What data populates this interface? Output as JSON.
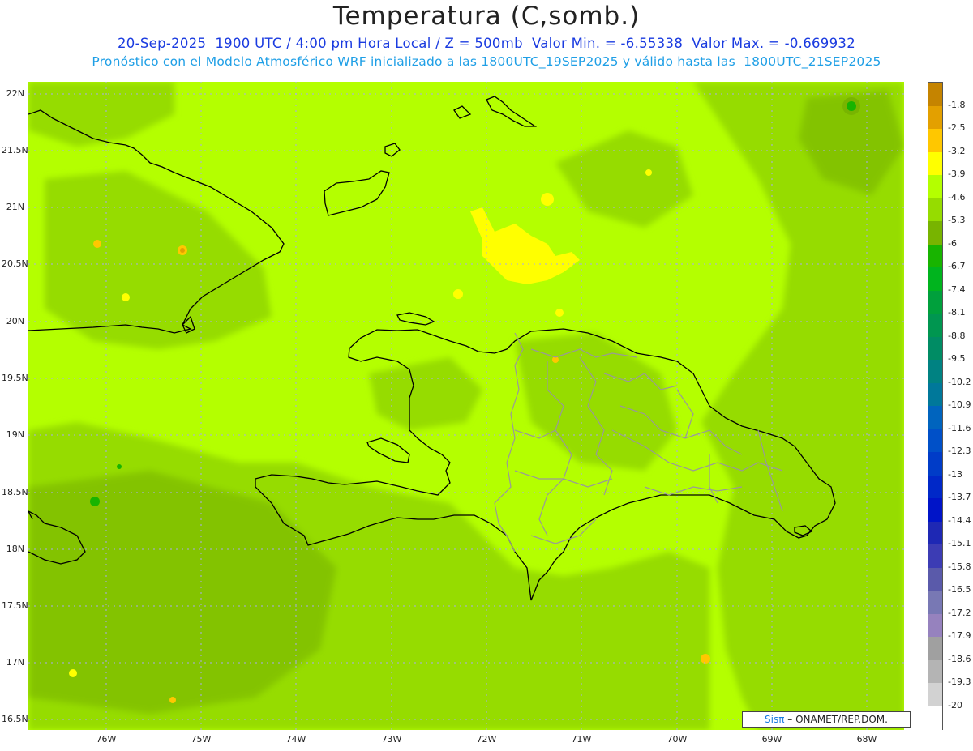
{
  "title": "Temperatura (C,somb.)",
  "subtitle_line1": "20-Sep-2025  1900 UTC / 4:00 pm Hora Local / Z = 500mb  Valor Min. = -6.55338  Valor Max. = -0.669932",
  "subtitle_line2": "Pronóstico con el Modelo Atmosférico WRF inicializado a las 1800UTC_19SEP2025 y válido hasta las  1800UTC_21SEP2025",
  "lat_labels": [
    "22N",
    "21.5N",
    "21N",
    "20.5N",
    "20N",
    "19.5N",
    "19N",
    "18.5N",
    "18N",
    "17.5N",
    "17N",
    "16.5N"
  ],
  "lon_labels": [
    "76W",
    "75W",
    "74W",
    "73W",
    "72W",
    "71W",
    "70W",
    "69W",
    "68W"
  ],
  "colorbar": {
    "labels": [
      "-1.8",
      "-2.5",
      "-3.2",
      "-3.9",
      "-4.6",
      "-5.3",
      "-6",
      "-6.7",
      "-7.4",
      "-8.1",
      "-8.8",
      "-9.5",
      "-10.2",
      "-10.9",
      "-11.6",
      "-12.3",
      "-13",
      "-13.7",
      "-14.4",
      "-15.1",
      "-15.8",
      "-16.5",
      "-17.2",
      "-17.9",
      "-18.6",
      "-19.3",
      "-20"
    ],
    "colors": [
      "#c58400",
      "#e3a000",
      "#ffc700",
      "#ffff00",
      "#b4ff00",
      "#96dc00",
      "#78b400",
      "#18b400",
      "#00b41e",
      "#00a03c",
      "#009650",
      "#008c64",
      "#008282",
      "#00789a",
      "#0064be",
      "#0050c8",
      "#003cc8",
      "#0028c8",
      "#0014c8",
      "#1e28b4",
      "#3c3cb4",
      "#5a5aaa",
      "#7878b4",
      "#9682be",
      "#a0a0a0",
      "#b4b4b4",
      "#d2d2d2",
      "#ffffff"
    ]
  },
  "credit": {
    "brand": "Sisπ",
    "org": "– ONAMET/REP.DOM."
  },
  "colors": {
    "field_base": "#b4ff00",
    "field_dark": "#96dc00",
    "field_darker": "#78b400",
    "field_light": "#ffff00",
    "coast": "#000000",
    "provinces": "#999999",
    "grid": "#aaaaee"
  }
}
